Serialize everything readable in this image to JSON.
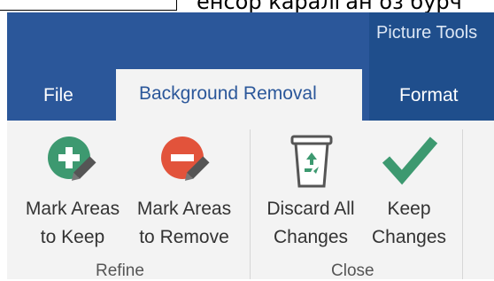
{
  "document": {
    "partial_text": "енсор каралган оз бурч"
  },
  "ribbon": {
    "tool_group": "Picture Tools",
    "tabs": [
      {
        "label": "File",
        "active": false
      },
      {
        "label": "Background Removal",
        "active": true
      },
      {
        "label": "Format",
        "active": false
      }
    ]
  },
  "groups": {
    "refine": {
      "label": "Refine",
      "mark_keep": {
        "line1": "Mark Areas",
        "line2": "to Keep",
        "icon": "plus-pencil-icon"
      },
      "mark_remove": {
        "line1": "Mark Areas",
        "line2": "to Remove",
        "icon": "minus-pencil-icon"
      }
    },
    "close": {
      "label": "Close",
      "discard": {
        "line1": "Discard All",
        "line2": "Changes",
        "icon": "recycle-bin-icon"
      },
      "keep": {
        "line1": "Keep",
        "line2": "Changes",
        "icon": "checkmark-icon"
      }
    }
  },
  "colors": {
    "ribbon_blue": "#2b579a",
    "tool_header": "#1f4e8c",
    "panel_bg": "#f3f3f3",
    "keep_green": "#3d9970",
    "remove_red": "#e2533b"
  }
}
